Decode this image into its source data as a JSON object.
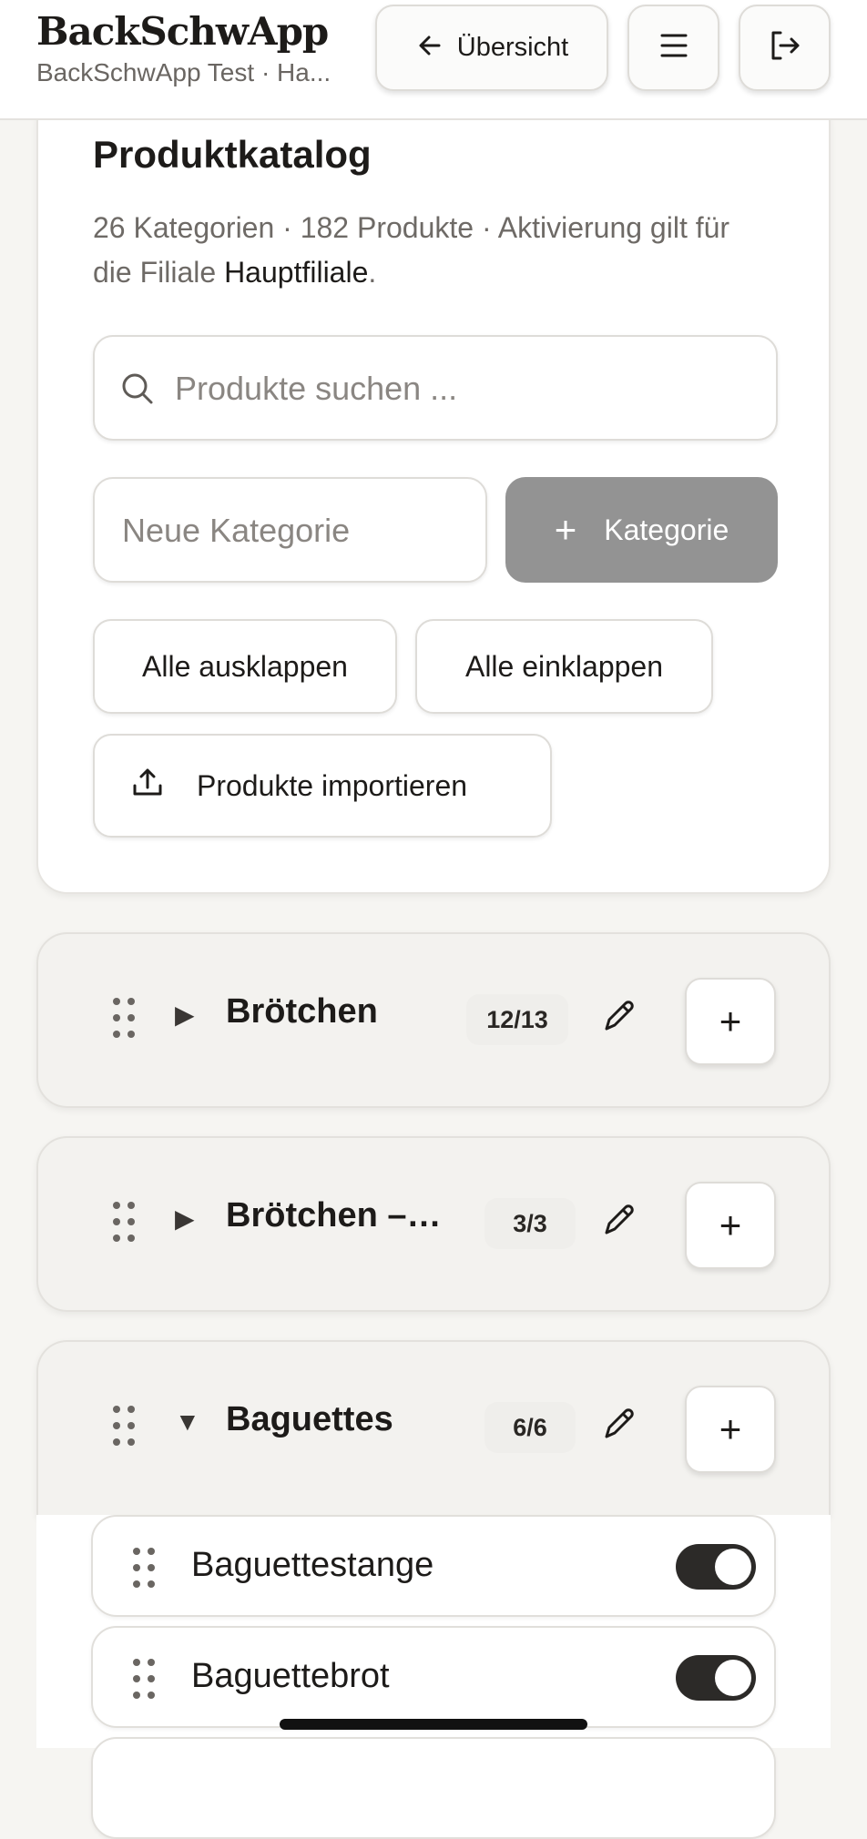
{
  "header": {
    "app_title": "BackSchwApp",
    "subtitle": "BackSchwApp Test · Ha...",
    "back_label": "Übersicht"
  },
  "catalog": {
    "title": "Produktkatalog",
    "info_prefix": "26 Kategorien · 182 Produkte · Aktivierung gilt für die Filiale ",
    "branch": "Hauptfiliale",
    "info_suffix": ".",
    "search_placeholder": "Produkte suchen ...",
    "new_category_placeholder": "Neue Kategorie",
    "add_category_label": "Kategorie",
    "expand_all_label": "Alle ausklappen",
    "collapse_all_label": "Alle einklappen",
    "import_label": "Produkte importieren"
  },
  "categories": [
    {
      "name": "Brötchen",
      "count": "12/13",
      "caret": "▶",
      "expanded": false
    },
    {
      "name": "Brötchen – ...",
      "count": "3/3",
      "caret": "▶",
      "expanded": false
    },
    {
      "name": "Baguettes",
      "count": "6/6",
      "caret": "▼",
      "expanded": true
    }
  ],
  "products": [
    {
      "name": "Baguettestange",
      "active": true
    },
    {
      "name": "Baguettebrot",
      "active": true
    }
  ],
  "colors": {
    "accent_dark": "#2c2a28",
    "button_disabled": "#939393",
    "background": "#f6f5f2"
  }
}
